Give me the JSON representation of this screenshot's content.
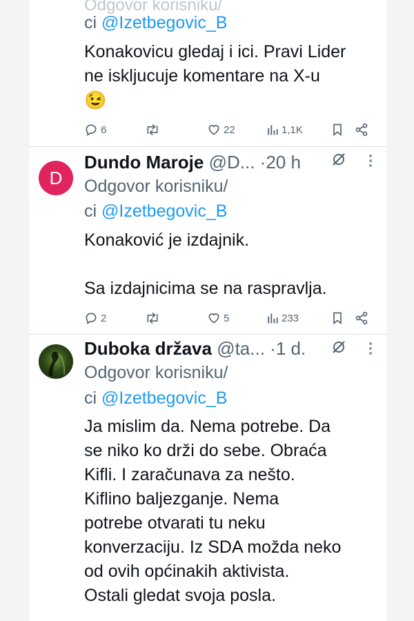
{
  "tweets": [
    {
      "reply_prefix": "ci ",
      "reply_handle": "@Izetbegovic_B",
      "body_lines": [
        "Konakovicu gledaj i ici. Pravi Lider",
        "ne iskljucuje komentare na X-u"
      ],
      "emoji": "😉",
      "replies": "6",
      "likes": "22",
      "views": "1,1K"
    },
    {
      "avatar_letter": "D",
      "name": "Dundo Maroje",
      "handle": "@D...",
      "dot": "·",
      "time": "20 h",
      "reply_label": "Odgovor korisniku/",
      "reply_prefix": "ci ",
      "reply_handle": "@Izetbegovic_B",
      "body_lines": [
        "Konaković je izdajnik.",
        "",
        "Sa izdajnicima se na raspravlja."
      ],
      "replies": "2",
      "likes": "5",
      "views": "233"
    },
    {
      "name": "Duboka država",
      "handle": "@ta...",
      "dot": "·",
      "time": "1 d.",
      "reply_label": "Odgovor korisniku/",
      "reply_prefix": "ci ",
      "reply_handle": "@Izetbegovic_B",
      "body_lines": [
        "Ja mislim da. Nema potrebe. Da",
        "se niko ko drži do sebe. Obraća",
        "Kifli. I zaračunava za nešto.",
        "Kiflino baljezganje. Nema",
        "potrebe otvarati tu neku",
        "konverzaciju. Iz SDA možda neko",
        "od ovih općinakih aktivista.",
        "Ostali gledat svoja posla."
      ]
    }
  ],
  "icons": {
    "reply": "reply-icon",
    "repost": "repost-icon",
    "like": "heart-icon",
    "views": "views-icon",
    "bookmark": "bookmark-icon",
    "share": "share-icon",
    "grok": "grok-icon",
    "more": "more-icon"
  },
  "colors": {
    "link": "#1d9bf0",
    "muted": "#536471",
    "avatar_bg": "#e0245e"
  }
}
